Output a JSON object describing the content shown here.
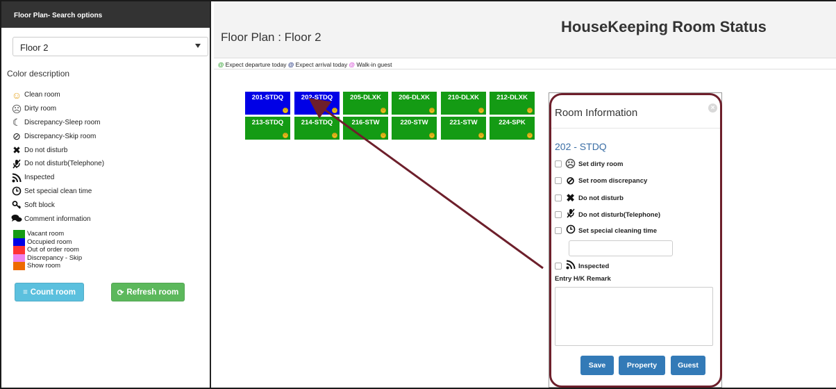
{
  "sidebar": {
    "header": "Floor Plan- Search options",
    "floor_select": "Floor 2",
    "color_description_label": "Color description",
    "status_legend": [
      {
        "icon": "smile-icon",
        "label": "Clean room"
      },
      {
        "icon": "sad-face-icon",
        "label": "Dirty room"
      },
      {
        "icon": "moon-icon",
        "label": "Discrepancy-Sleep room"
      },
      {
        "icon": "no-entry-icon",
        "label": "Discrepancy-Skip room"
      },
      {
        "icon": "x-icon",
        "label": "Do not disturb"
      },
      {
        "icon": "muted-phone-icon",
        "label": "Do not disturb(Telephone)"
      },
      {
        "icon": "rss-icon",
        "label": "Inspected"
      },
      {
        "icon": "clock-icon",
        "label": "Set special clean time"
      },
      {
        "icon": "key-icon",
        "label": "Soft block"
      },
      {
        "icon": "comments-icon",
        "label": "Comment information"
      }
    ],
    "color_legend": [
      {
        "color": "#149b14",
        "label": "Vacant room"
      },
      {
        "color": "#0000e6",
        "label": "Occupied room"
      },
      {
        "color": "#ff3333",
        "label": "Out of order room"
      },
      {
        "color": "#ee82ee",
        "label": "Discrepancy - Skip"
      },
      {
        "color": "#ee6a00",
        "label": "Show room"
      }
    ],
    "count_button": "Count room",
    "refresh_button": "Refresh room"
  },
  "header": {
    "floor_title": "Floor Plan : Floor 2",
    "page_title": "HouseKeeping Room Status"
  },
  "expect_bar": {
    "departure": "Expect departure today",
    "arrival": "Expect arrival today",
    "walkin": "Walk-in guest",
    "at_symbol": "@"
  },
  "rooms": [
    {
      "label": "201-STDQ",
      "status": "occupied"
    },
    {
      "label": "202-STDQ",
      "status": "occupied"
    },
    {
      "label": "205-DLXK",
      "status": "vacant"
    },
    {
      "label": "206-DLXK",
      "status": "vacant"
    },
    {
      "label": "210-DLXK",
      "status": "vacant"
    },
    {
      "label": "212-DLXK",
      "status": "vacant"
    },
    {
      "label": "213-STDQ",
      "status": "vacant"
    },
    {
      "label": "214-STDQ",
      "status": "vacant"
    },
    {
      "label": "216-STW",
      "status": "vacant"
    },
    {
      "label": "220-STW",
      "status": "vacant"
    },
    {
      "label": "221-STW",
      "status": "vacant"
    },
    {
      "label": "224-SPK",
      "status": "vacant"
    }
  ],
  "room_info": {
    "title": "Room Information",
    "close": "×",
    "room_no": "202 - STDQ",
    "options": [
      {
        "icon": "sad-face-icon",
        "label": "Set dirty room"
      },
      {
        "icon": "no-entry-icon",
        "label": "Set room discrepancy"
      },
      {
        "icon": "x-icon",
        "label": "Do not disturb"
      },
      {
        "icon": "muted-phone-icon",
        "label": "Do not disturb(Telephone)"
      },
      {
        "icon": "clock-icon",
        "label": "Set special cleaning time"
      }
    ],
    "inspected_label": "Inspected",
    "remark_label": "Entry H/K Remark",
    "save_button": "Save",
    "property_button": "Property",
    "guest_button": "Guest"
  }
}
